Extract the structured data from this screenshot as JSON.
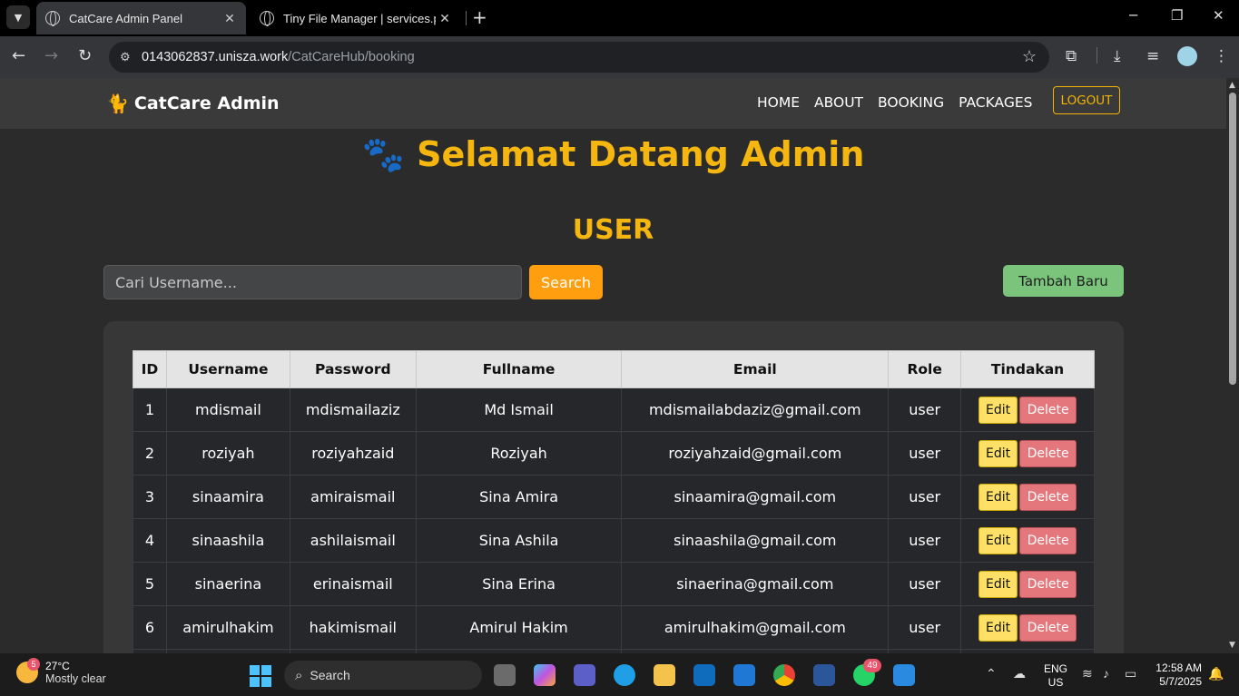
{
  "browser": {
    "tabs": [
      {
        "title": "CatCare Admin Panel",
        "active": true
      },
      {
        "title": "Tiny File Manager | services.php",
        "active": false
      }
    ],
    "url_host": "0143062837.unisza.work",
    "url_path": "/CatCareHub/booking"
  },
  "navbar": {
    "brand": "CatCare Admin",
    "items": [
      "HOME",
      "ABOUT",
      "BOOKING",
      "PACKAGES"
    ],
    "logout": "LOGOUT"
  },
  "welcome": "Selamat Datang Admin",
  "section_title": "USER",
  "search": {
    "placeholder": "Cari Username...",
    "button": "Search"
  },
  "add_button": "Tambah Baru",
  "table": {
    "headers": [
      "ID",
      "Username",
      "Password",
      "Fullname",
      "Email",
      "Role",
      "Tindakan"
    ],
    "rows": [
      [
        "1",
        "mdismail",
        "mdismailaziz",
        "Md Ismail",
        "mdismailabdaziz@gmail.com",
        "user"
      ],
      [
        "2",
        "roziyah",
        "roziyahzaid",
        "Roziyah",
        "roziyahzaid@gmail.com",
        "user"
      ],
      [
        "3",
        "sinaamira",
        "amiraismail",
        "Sina Amira",
        "sinaamira@gmail.com",
        "user"
      ],
      [
        "4",
        "sinaashila",
        "ashilaismail",
        "Sina Ashila",
        "sinaashila@gmail.com",
        "user"
      ],
      [
        "5",
        "sinaerina",
        "erinaismail",
        "Sina Erina",
        "sinaerina@gmail.com",
        "user"
      ],
      [
        "6",
        "amirulhakim",
        "hakimismail",
        "Amirul Hakim",
        "amirulhakim@gmail.com",
        "user"
      ]
    ],
    "edit_label": "Edit",
    "delete_label": "Delete"
  },
  "taskbar": {
    "weather_temp": "27°C",
    "weather_desc": "Mostly clear",
    "weather_badge": "5",
    "search_label": "Search",
    "whatsapp_badge": "49",
    "lang1": "ENG",
    "lang2": "US",
    "time": "12:58 AM",
    "date": "5/7/2025"
  },
  "colors": {
    "accent": "#f5b60f",
    "search_button": "#ff9f0f",
    "add_button": "#7ac57b",
    "edit": "#ffe066",
    "delete": "#e4777c"
  }
}
